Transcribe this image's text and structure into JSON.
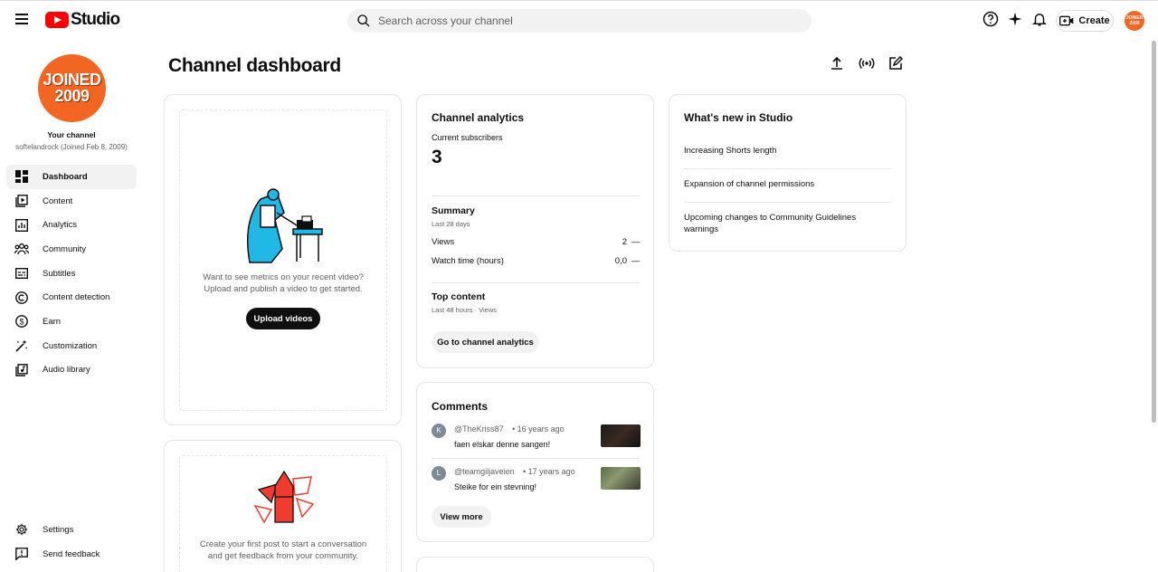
{
  "app": {
    "brand": "Studio"
  },
  "search": {
    "placeholder": "Search across your channel"
  },
  "topbar": {
    "create_label": "Create",
    "avatar_text": "JOINED 2009"
  },
  "channel": {
    "avatar_text_line1": "JOINED",
    "avatar_text_line2": "2009",
    "your_channel_label": "Your channel",
    "subtitle": "softelandrock (Joined Feb 8, 2009)"
  },
  "sidebar": {
    "items": [
      {
        "label": "Dashboard",
        "icon": "dashboard-icon",
        "active": true
      },
      {
        "label": "Content",
        "icon": "content-icon"
      },
      {
        "label": "Analytics",
        "icon": "analytics-icon"
      },
      {
        "label": "Community",
        "icon": "community-icon"
      },
      {
        "label": "Subtitles",
        "icon": "subtitles-icon"
      },
      {
        "label": "Content detection",
        "icon": "copyright-icon"
      },
      {
        "label": "Earn",
        "icon": "dollar-icon"
      },
      {
        "label": "Customization",
        "icon": "magic-wand-icon"
      },
      {
        "label": "Audio library",
        "icon": "audio-library-icon"
      }
    ],
    "bottom": [
      {
        "label": "Settings",
        "icon": "gear-icon"
      },
      {
        "label": "Send feedback",
        "icon": "feedback-icon"
      }
    ]
  },
  "main": {
    "title": "Channel dashboard",
    "upload_card": {
      "text_line1": "Want to see metrics on your recent video?",
      "text_line2": "Upload and publish a video to get started.",
      "button": "Upload videos"
    },
    "post_card": {
      "text_line1": "Create your first post to start a conversation",
      "text_line2": "and get feedback from your community."
    },
    "analytics": {
      "title": "Channel analytics",
      "subscribers_label": "Current subscribers",
      "subscribers_value": "3",
      "summary_title": "Summary",
      "summary_period": "Last 28 days",
      "rows": [
        {
          "label": "Views",
          "value": "2",
          "change": "—"
        },
        {
          "label": "Watch time (hours)",
          "value": "0,0",
          "change": "—"
        }
      ],
      "top_content_title": "Top content",
      "top_content_period": "Last 48 hours · Views",
      "button": "Go to channel analytics"
    },
    "comments": {
      "title": "Comments",
      "items": [
        {
          "initial": "K",
          "author": "@TheKriss87",
          "age": "• 16 years ago",
          "text": "faen elskar denne sangen!",
          "avatar_color": "#7e8a96"
        },
        {
          "initial": "L",
          "author": "@teamgiljaveien",
          "age": "• 17 years ago",
          "text": "Steike for ein stevning!",
          "avatar_color": "#7e8a96"
        }
      ],
      "button": "View more"
    },
    "whats_new": {
      "title": "What's new in Studio",
      "items": [
        "Increasing Shorts length",
        "Expansion of channel permissions",
        "Upcoming changes to Community Guidelines warnings"
      ]
    }
  },
  "colors": {
    "brand_red": "#ff0000",
    "avatar_orange": "#f26522"
  }
}
